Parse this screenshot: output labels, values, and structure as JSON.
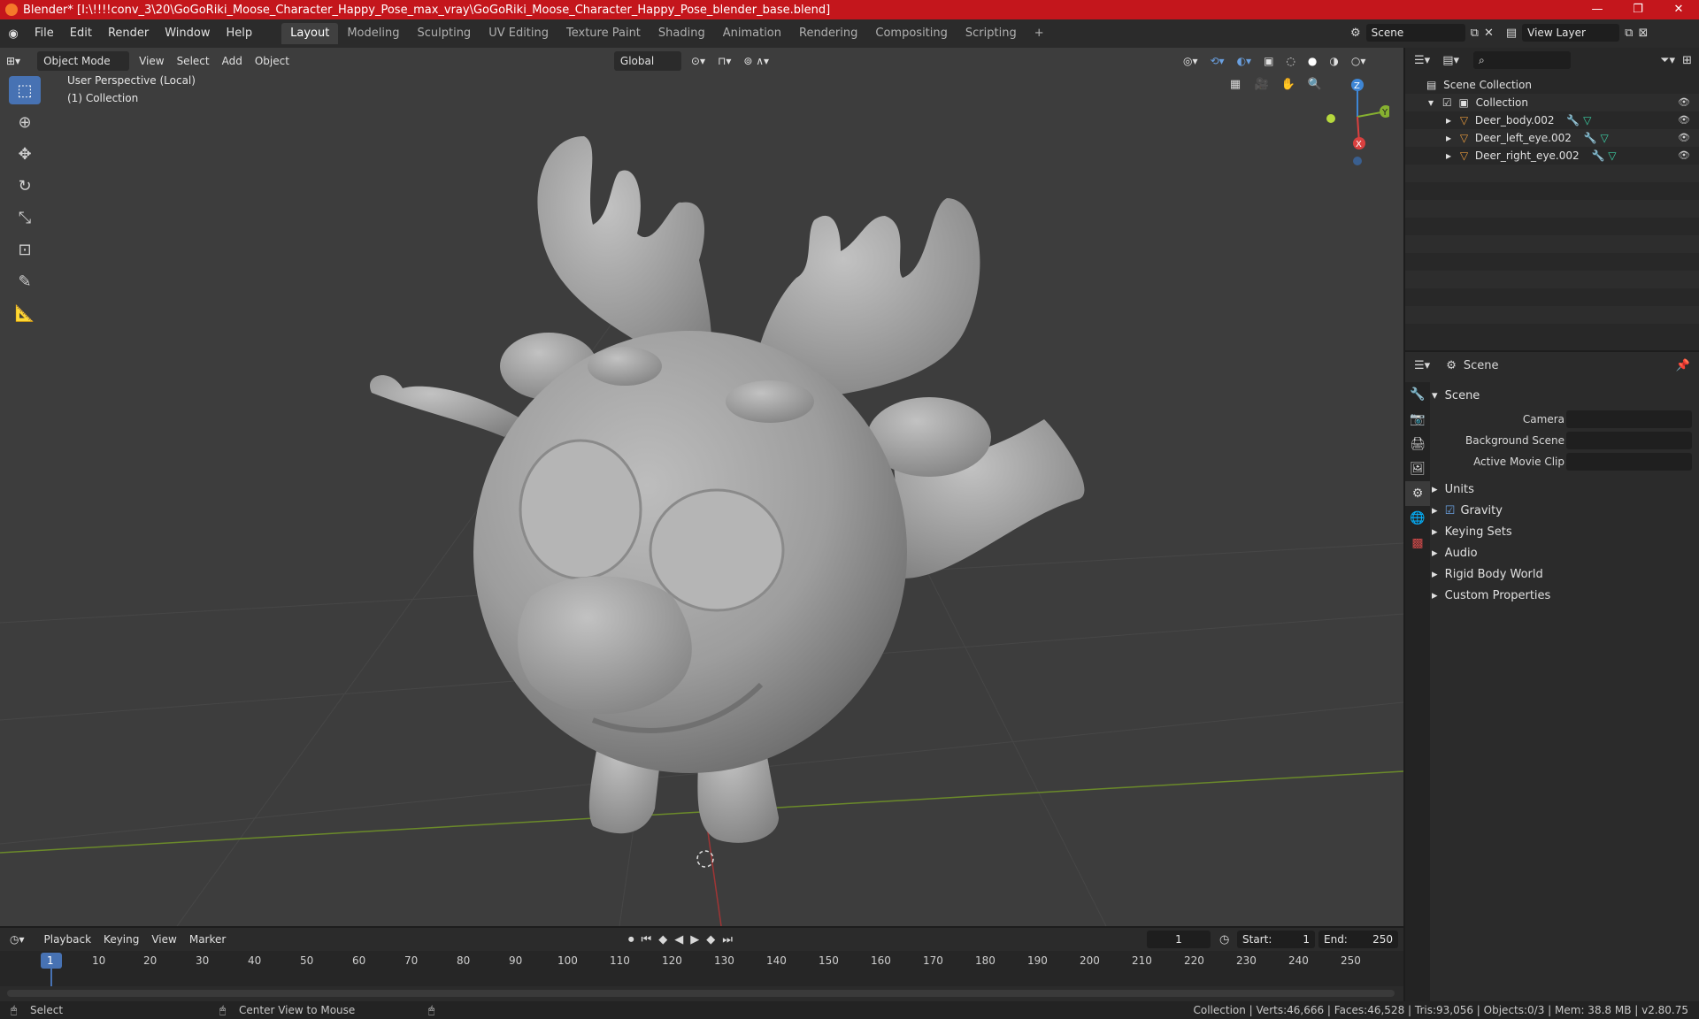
{
  "titlebar": {
    "title": "Blender* [I:\\!!!!conv_3\\20\\GoGoRiki_Moose_Character_Happy_Pose_max_vray\\GoGoRiki_Moose_Character_Happy_Pose_blender_base.blend]",
    "minimize": "—",
    "maximize": "❐",
    "close": "✕"
  },
  "menu": [
    "File",
    "Edit",
    "Render",
    "Window",
    "Help"
  ],
  "workspaces": [
    "Layout",
    "Modeling",
    "Sculpting",
    "UV Editing",
    "Texture Paint",
    "Shading",
    "Animation",
    "Rendering",
    "Compositing",
    "Scripting",
    "+"
  ],
  "scene_field": "Scene",
  "view_layer_field": "View Layer",
  "viewport_header": {
    "mode": "Object Mode",
    "view": "View",
    "select": "Select",
    "add": "Add",
    "object": "Object",
    "transform": "Global"
  },
  "viewport_info": {
    "perspective": "User Perspective (Local)",
    "collection": "(1) Collection"
  },
  "gizmo": {
    "z": "Z",
    "y": "Y",
    "x": "X"
  },
  "outliner": {
    "root": "Scene Collection",
    "collection": "Collection",
    "items": [
      "Deer_body.002",
      "Deer_left_eye.002",
      "Deer_right_eye.002"
    ]
  },
  "properties": {
    "header": "Scene",
    "panel": "Scene",
    "camera_label": "Camera",
    "bg_scene_label": "Background Scene",
    "movie_clip_label": "Active Movie Clip",
    "sections": [
      "Units",
      "Gravity",
      "Keying Sets",
      "Audio",
      "Rigid Body World",
      "Custom Properties"
    ]
  },
  "timeline": {
    "playback": "Playback",
    "keying": "Keying",
    "view": "View",
    "marker": "Marker",
    "current_frame": "1",
    "start_label": "Start:",
    "start": "1",
    "end_label": "End:",
    "end": "250",
    "ticks": [
      "1",
      "10",
      "20",
      "30",
      "40",
      "50",
      "60",
      "70",
      "80",
      "90",
      "100",
      "110",
      "120",
      "130",
      "140",
      "150",
      "160",
      "170",
      "180",
      "190",
      "200",
      "210",
      "220",
      "230",
      "240",
      "250"
    ]
  },
  "statusbar": {
    "select": "Select",
    "center_view": "Center View to Mouse",
    "stats": "Collection | Verts:46,666 | Faces:46,528 | Tris:93,056 | Objects:0/3 | Mem: 38.8 MB | v2.80.75"
  },
  "colors": {
    "title_red": "#c4161c",
    "active_blue": "#4772b3",
    "viewport_bg": "#3d3d3d",
    "x_axis": "#d9403f",
    "y_axis": "#86b130",
    "z_axis": "#3e86d5"
  }
}
